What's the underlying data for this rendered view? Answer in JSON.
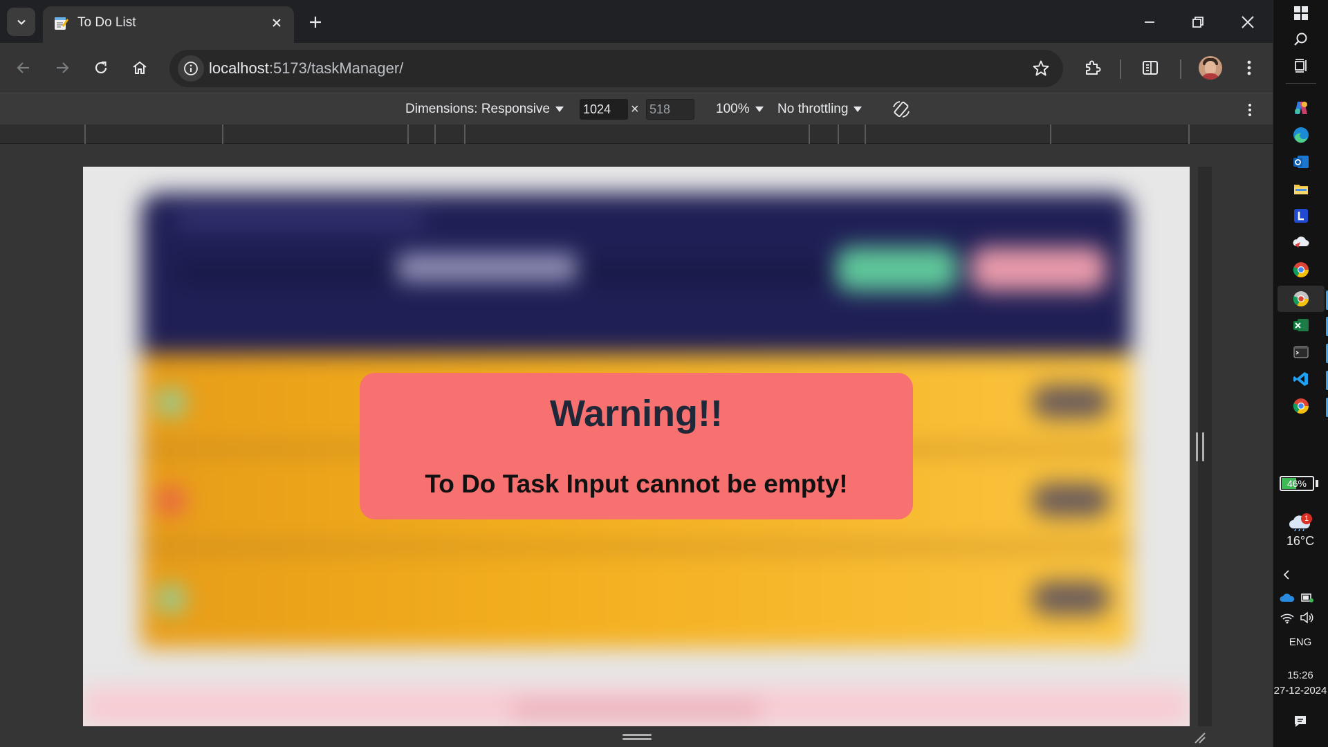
{
  "browser": {
    "tab": {
      "title": "To Do List"
    },
    "address": {
      "host": "localhost",
      "rest": ":5173/taskManager/"
    }
  },
  "devtools": {
    "dimensions_label": "Dimensions: Responsive",
    "width": "1024",
    "height": "518",
    "times": "×",
    "zoom": "100%",
    "throttling": "No throttling"
  },
  "app": {
    "modal": {
      "title": "Warning!!",
      "message": "To Do Task Input cannot be empty!"
    }
  },
  "taskbar": {
    "battery": "46%",
    "weather": {
      "temp": "16°C",
      "badge": "1"
    },
    "language": "ENG",
    "time": "15:26",
    "date": "27-12-2024"
  },
  "colors": {
    "modal_bg": "#f87171",
    "header_bg": "#1f1f55",
    "row_gradient": [
      "#e79c18",
      "#fbc43f"
    ],
    "green_button": "#5fc79a",
    "pink_button": "#e89aaa"
  }
}
